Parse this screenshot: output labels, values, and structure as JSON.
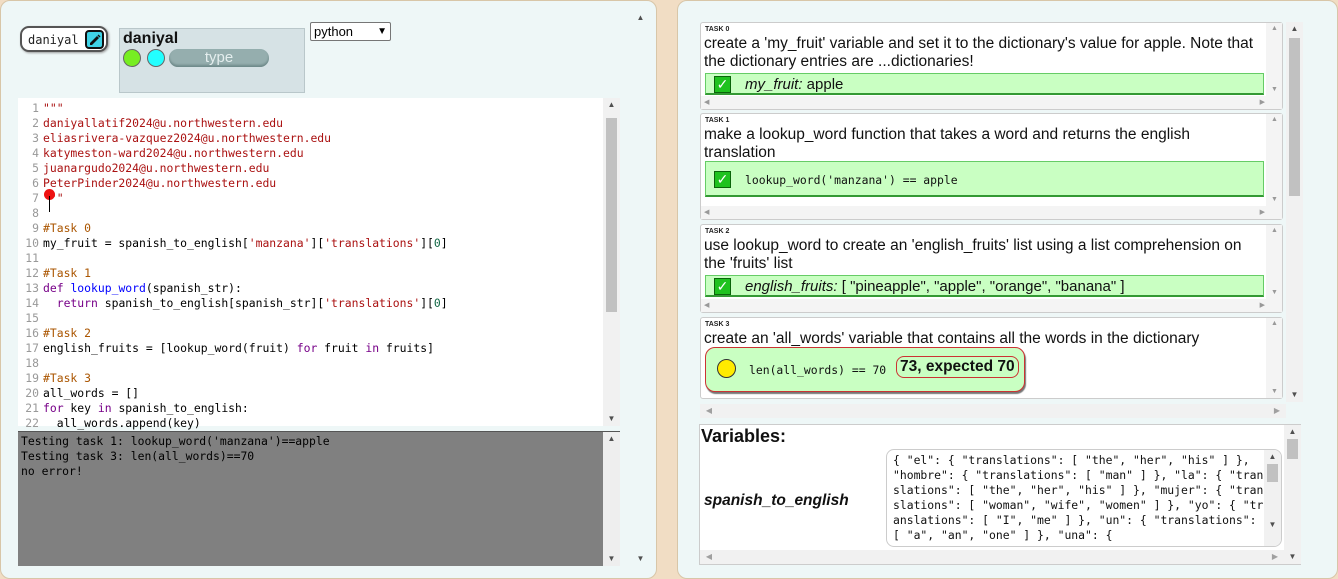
{
  "user": {
    "username": "daniyal",
    "display_name": "daniyal",
    "type_label": "type"
  },
  "language_select": {
    "value": "python"
  },
  "editor": {
    "lines": [
      [
        {
          "c": "tk-str",
          "t": "\"\"\""
        }
      ],
      [
        {
          "c": "tk-str",
          "t": "daniyallatif2024@u.northwestern.edu"
        }
      ],
      [
        {
          "c": "tk-str",
          "t": "eliasrivera-vazquez2024@u.northwestern.edu"
        }
      ],
      [
        {
          "c": "tk-str",
          "t": "katymeston-ward2024@u.northwestern.edu"
        }
      ],
      [
        {
          "c": "tk-str",
          "t": "juanargudo2024@u.northwestern.edu"
        }
      ],
      [
        {
          "c": "tk-str",
          "t": "PeterPinder2024@u.northwestern.edu"
        }
      ],
      [
        {
          "c": "tk-str",
          "t": "\"\"\""
        }
      ],
      [
        {
          "c": "tk-txt",
          "t": ""
        }
      ],
      [
        {
          "c": "tk-cm",
          "t": "#Task 0"
        }
      ],
      [
        {
          "c": "tk-txt",
          "t": "my_fruit = spanish_to_english["
        },
        {
          "c": "tk-str",
          "t": "'manzana'"
        },
        {
          "c": "tk-txt",
          "t": "]["
        },
        {
          "c": "tk-str",
          "t": "'translations'"
        },
        {
          "c": "tk-txt",
          "t": "]["
        },
        {
          "c": "tk-num",
          "t": "0"
        },
        {
          "c": "tk-txt",
          "t": "]"
        }
      ],
      [
        {
          "c": "tk-txt",
          "t": ""
        }
      ],
      [
        {
          "c": "tk-cm",
          "t": "#Task 1"
        }
      ],
      [
        {
          "c": "tk-kw",
          "t": "def "
        },
        {
          "c": "tk-def",
          "t": "lookup_word"
        },
        {
          "c": "tk-txt",
          "t": "(spanish_str):"
        }
      ],
      [
        {
          "c": "tk-kw",
          "t": "  return "
        },
        {
          "c": "tk-txt",
          "t": "spanish_to_english[spanish_str]["
        },
        {
          "c": "tk-str",
          "t": "'translations'"
        },
        {
          "c": "tk-txt",
          "t": "]["
        },
        {
          "c": "tk-num",
          "t": "0"
        },
        {
          "c": "tk-txt",
          "t": "]"
        }
      ],
      [
        {
          "c": "tk-txt",
          "t": ""
        }
      ],
      [
        {
          "c": "tk-cm",
          "t": "#Task 2"
        }
      ],
      [
        {
          "c": "tk-txt",
          "t": "english_fruits = [lookup_word(fruit) "
        },
        {
          "c": "tk-kw",
          "t": "for"
        },
        {
          "c": "tk-txt",
          "t": " fruit "
        },
        {
          "c": "tk-kw",
          "t": "in"
        },
        {
          "c": "tk-txt",
          "t": " fruits]"
        }
      ],
      [
        {
          "c": "tk-txt",
          "t": ""
        }
      ],
      [
        {
          "c": "tk-cm",
          "t": "#Task 3"
        }
      ],
      [
        {
          "c": "tk-txt",
          "t": "all_words = []"
        }
      ],
      [
        {
          "c": "tk-kw",
          "t": "for"
        },
        {
          "c": "tk-txt",
          "t": " key "
        },
        {
          "c": "tk-kw",
          "t": "in"
        },
        {
          "c": "tk-txt",
          "t": " spanish_to_english:"
        }
      ],
      [
        {
          "c": "tk-txt",
          "t": "  all_words.append(key)"
        }
      ]
    ]
  },
  "console": {
    "lines": [
      "Testing task 1: lookup_word('manzana')==apple",
      "Testing task 3: len(all_words)==70",
      "no error!"
    ]
  },
  "tasks": [
    {
      "tag": "TASK 0",
      "description": "create a 'my_fruit' variable and set it to the dictionary's value for apple. Note that the dictionary entries are ...dictionaries!",
      "result_var": "my_fruit:",
      "result_val": " apple"
    },
    {
      "tag": "TASK 1",
      "description": "make a lookup_word function that takes a word and returns the english translation",
      "result_code": "lookup_word('manzana') == apple"
    },
    {
      "tag": "TASK 2",
      "description": "use lookup_word to create an 'english_fruits' list using a list comprehension on the 'fruits' list",
      "result_var": "english_fruits:",
      "result_val": " [ \"pineapple\", \"apple\", \"orange\", \"banana\" ]"
    },
    {
      "tag": "TASK 3",
      "description": "create an 'all_words' variable that contains all the words in the dictionary",
      "result_code": "len(all_words) == 70",
      "result_error": "73, expected 70"
    }
  ],
  "variables": {
    "title": "Variables:",
    "name": "spanish_to_english",
    "value": "{ \"el\": { \"translations\": [ \"the\", \"her\", \"his\" ] }, \"hombre\": { \"translations\": [ \"man\" ] }, \"la\": { \"translations\": [ \"the\", \"her\", \"his\" ] }, \"mujer\": { \"translations\": [ \"woman\", \"wife\", \"women\" ] }, \"yo\": { \"translations\": [ \"I\", \"me\" ] }, \"un\": { \"translations\": [ \"a\", \"an\", \"one\" ] }, \"una\": {"
  },
  "colors": {
    "pass": "#c9ffc2",
    "fail_bg": "#c9ffc2",
    "fail_border": "#c33",
    "pending_dot": "#ffeb00",
    "dot_green": "#77ee22",
    "dot_cyan": "#22ffff"
  }
}
